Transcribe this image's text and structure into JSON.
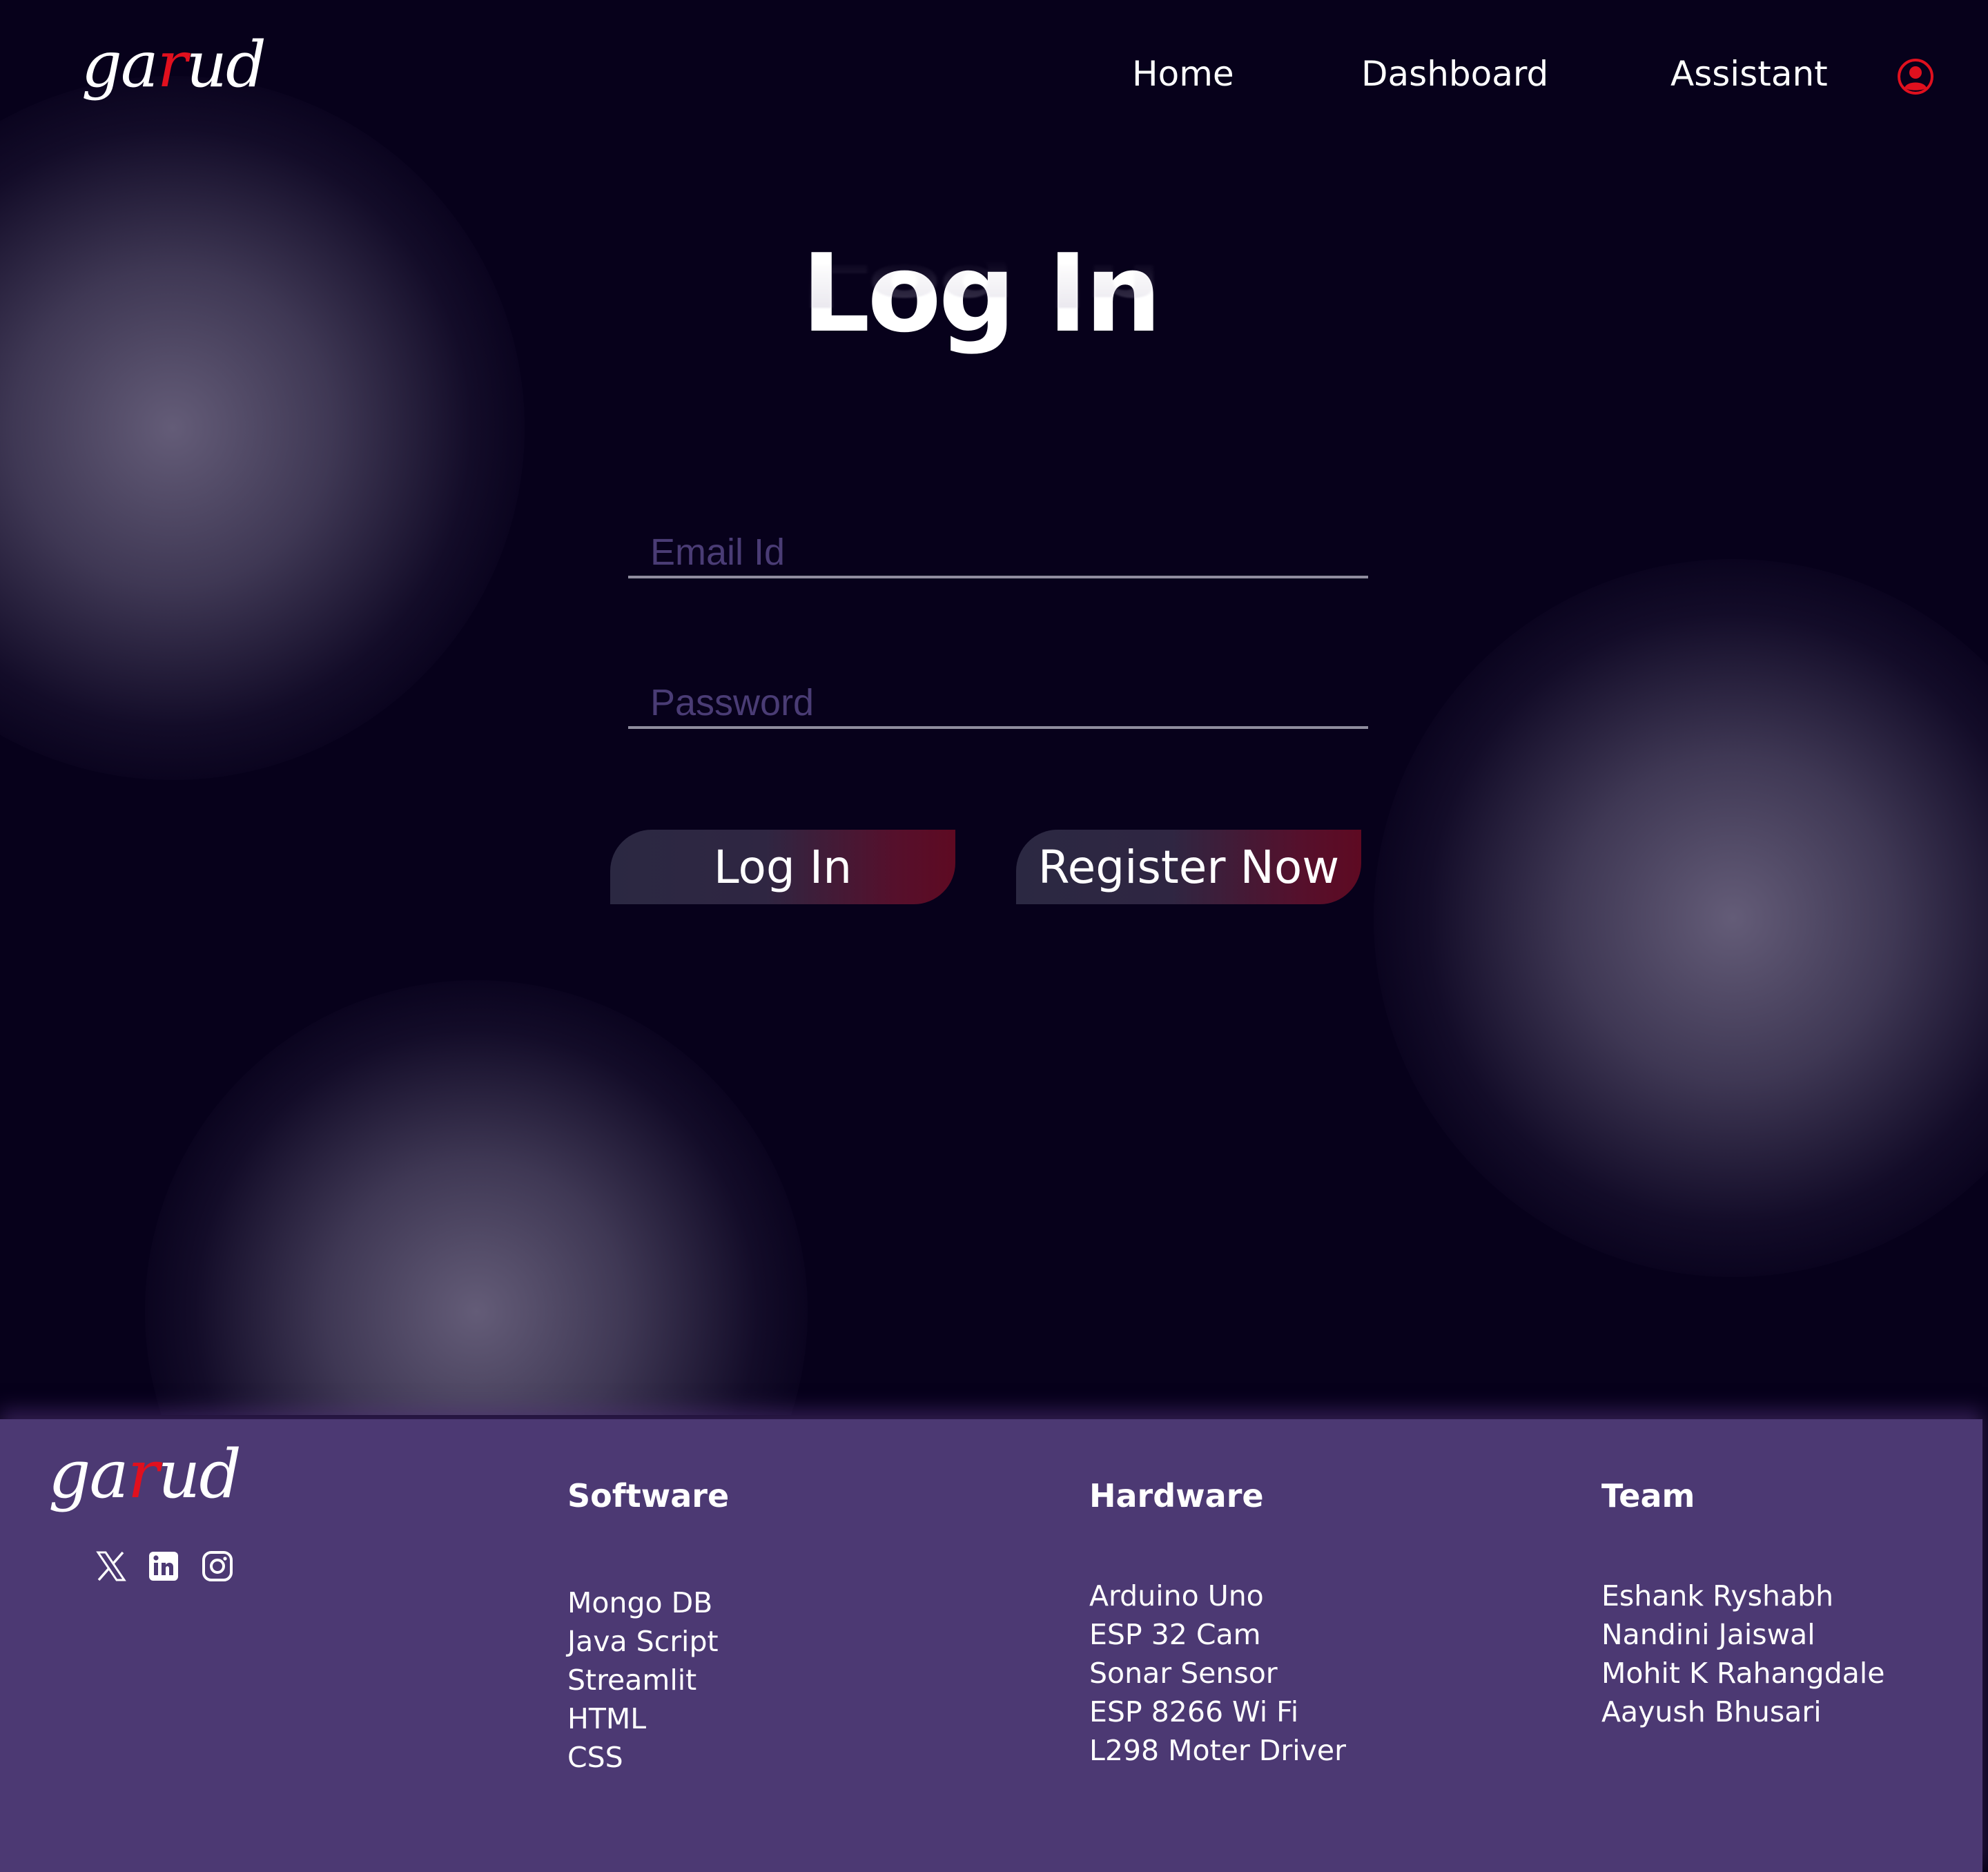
{
  "header": {
    "logo_text_1": "ga",
    "logo_text_r": "r",
    "logo_text_2": "ud",
    "nav": [
      "Home",
      "Dashboard",
      "Assistant"
    ],
    "user_icon": "user-circle-icon"
  },
  "login": {
    "title": "Log In",
    "email_placeholder": "Email Id",
    "password_placeholder": "Password",
    "login_button": "Log In",
    "register_button": "Register Now"
  },
  "footer": {
    "social_icons": [
      "x-icon",
      "linkedin-icon",
      "instagram-icon"
    ],
    "software": {
      "heading": "Software",
      "items": [
        "Mongo DB",
        "Java Script",
        "Streamlit",
        "HTML",
        "CSS"
      ]
    },
    "hardware": {
      "heading": "Hardware",
      "items": [
        "Arduino Uno",
        "ESP 32 Cam",
        "Sonar Sensor",
        "ESP 8266 Wi Fi",
        "L298 Moter Driver"
      ]
    },
    "team": {
      "heading": "Team",
      "items": [
        "Eshank Ryshabh",
        "Nandini Jaiswal",
        "Mohit K Rahangdale",
        "Aayush Bhusari"
      ]
    }
  },
  "colors": {
    "background": "#07011b",
    "footer": "#4c3973",
    "accent_red": "#e0101e",
    "button_gradient_end": "#5e0a22"
  }
}
